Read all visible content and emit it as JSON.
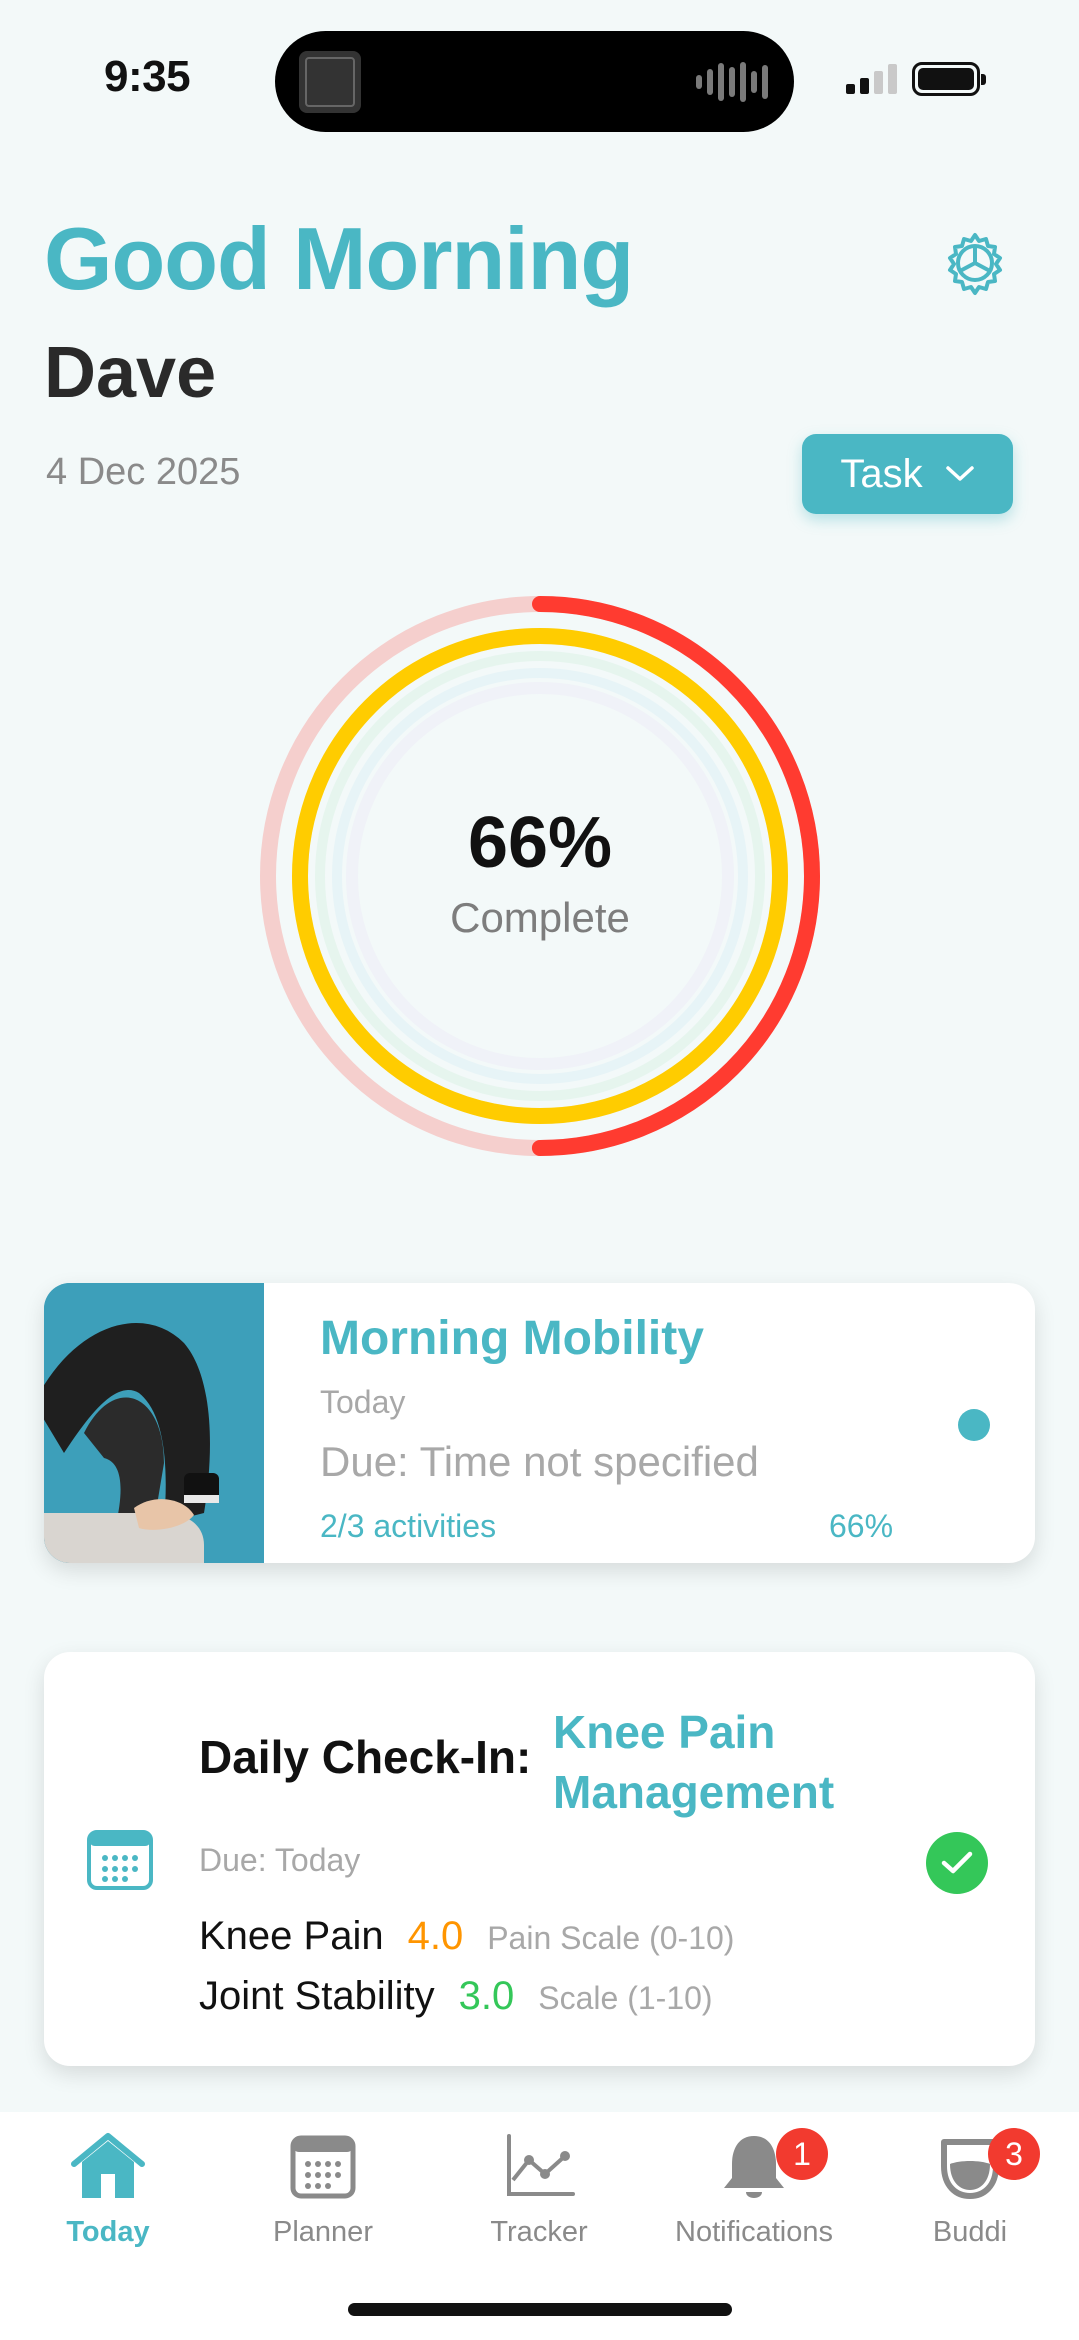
{
  "status_bar": {
    "time": "9:35"
  },
  "header": {
    "greeting": "Good Morning",
    "user_name": "Dave",
    "date": "4 Dec 2025",
    "task_button_label": "Task"
  },
  "progress": {
    "percent_label": "66%",
    "caption": "Complete",
    "rings": [
      {
        "color": "#ff3b30",
        "value": 0.5
      },
      {
        "color": "#ffcc00",
        "value": 1.0
      },
      {
        "color": "#b9e8c8",
        "value": 0.0
      },
      {
        "color": "#bfe3f3",
        "value": 0.0
      },
      {
        "color": "#e6dcf6",
        "value": 0.0
      }
    ]
  },
  "cards": {
    "mobility": {
      "title": "Morning Mobility",
      "day": "Today",
      "due": "Due: Time not specified",
      "activities": "2/3 activities",
      "percent": "66%"
    },
    "checkin": {
      "title": "Daily Check-In:",
      "topic": "Knee Pain Management",
      "due": "Due: Today",
      "metrics": [
        {
          "name": "Knee Pain",
          "value": "4.0",
          "scale": "Pain Scale (0-10)",
          "color": "#ff9500"
        },
        {
          "name": "Joint Stability",
          "value": "3.0",
          "scale": "Scale (1-10)",
          "color": "#34c759"
        }
      ]
    }
  },
  "tabbar": {
    "tabs": [
      {
        "label": "Today",
        "icon": "home-icon"
      },
      {
        "label": "Planner",
        "icon": "calendar-icon"
      },
      {
        "label": "Tracker",
        "icon": "chart-icon"
      },
      {
        "label": "Notifications",
        "icon": "bell-icon",
        "badge": "1"
      },
      {
        "label": "Buddi",
        "icon": "buddi-icon",
        "badge": "3"
      }
    ]
  }
}
